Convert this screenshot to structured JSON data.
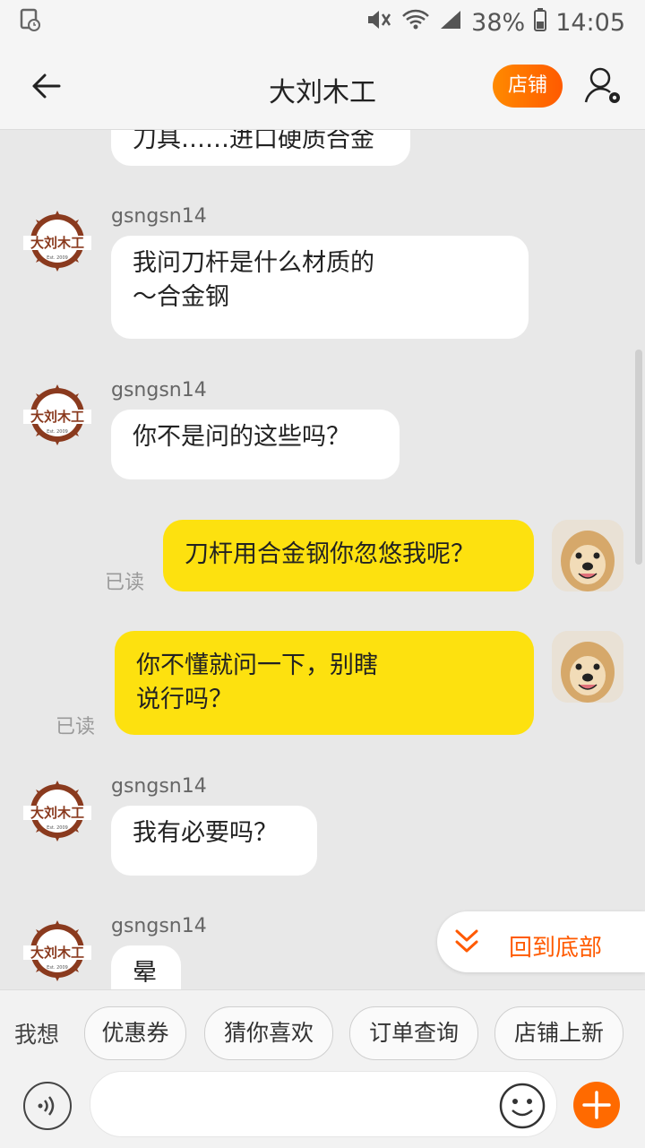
{
  "status": {
    "time": "14:05",
    "battery": "38%"
  },
  "header": {
    "title": "大刘木工",
    "shop_label": "店铺"
  },
  "messages": [
    {
      "side": "them",
      "text": "刀具……进口硬质合金"
    },
    {
      "side": "them",
      "name": "gsngsn14",
      "text": "我问刀杆是什么材质的\n～合金钢"
    },
    {
      "side": "them",
      "name": "gsngsn14",
      "text": "你不是问的这些吗？"
    },
    {
      "side": "me",
      "text": "刀杆用合金钢你忽悠我呢？",
      "read": "已读"
    },
    {
      "side": "me",
      "text": "你不懂就问一下，别瞎\n说行吗？",
      "read": "已读"
    },
    {
      "side": "them",
      "name": "gsngsn14",
      "text": "我有必要吗？"
    },
    {
      "side": "them",
      "name": "gsngsn14",
      "text": "晕"
    }
  ],
  "scroll_bottom_label": "回到底部",
  "quickbar": {
    "want_label": "我想",
    "chips": [
      "优惠券",
      "猜你喜欢",
      "订单查询",
      "店铺上新"
    ]
  },
  "logo_text": "大刘木工",
  "logo_sub": "Est. 2009"
}
